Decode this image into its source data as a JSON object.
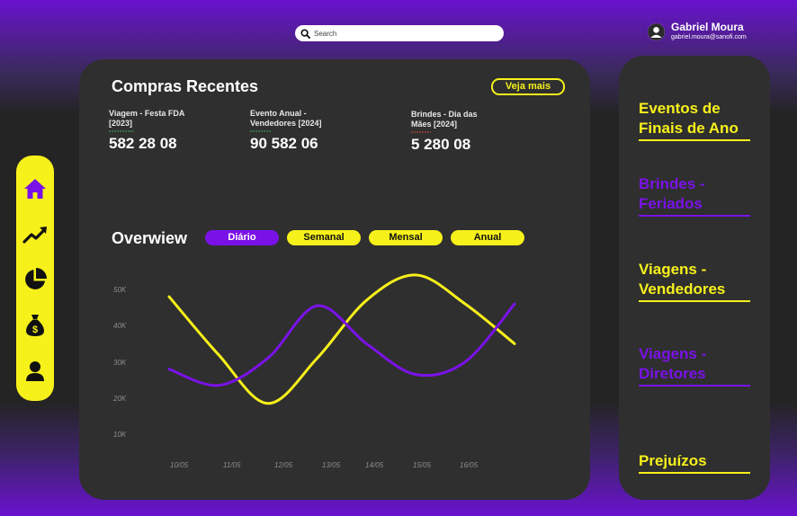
{
  "search": {
    "placeholder": "Search"
  },
  "user": {
    "name": "Gabriel Moura",
    "email": "gabriel.moura@sanofi.com"
  },
  "recent": {
    "title": "Compras Recentes",
    "see_more": "Veja mais",
    "items": [
      {
        "title_line1": "Viagem - Festa FDA",
        "title_line2": "[2023]",
        "amount": "582 28 08",
        "spark_color": "#3fae5a"
      },
      {
        "title_line1": "Evento Anual -",
        "title_line2": "Vendedores [2024]",
        "amount": "90 582 06",
        "spark_color": "#3fae5a"
      },
      {
        "title_line1": "Brindes - Dia das",
        "title_line2": "Mães [2024]",
        "amount": "5 280 08",
        "spark_color": "#d9483b"
      }
    ]
  },
  "overview": {
    "title": "Overwiew",
    "periods": [
      {
        "label": "Diário",
        "active": true
      },
      {
        "label": "Semanal",
        "active": false
      },
      {
        "label": "Mensal",
        "active": false
      },
      {
        "label": "Anual",
        "active": false
      }
    ]
  },
  "nav": {
    "items": [
      {
        "icon": "home-icon"
      },
      {
        "icon": "trending-up-icon"
      },
      {
        "icon": "pie-chart-icon"
      },
      {
        "icon": "money-bag-icon"
      },
      {
        "icon": "user-icon"
      }
    ]
  },
  "side_links": [
    {
      "line1": "Eventos de",
      "line2": "Finais de Ano",
      "color": "#f7f11b"
    },
    {
      "line1": "Brindes -",
      "line2": "Feriados",
      "color": "#7a12e8"
    },
    {
      "line1": "Viagens -",
      "line2": "Vendedores",
      "color": "#f7f11b"
    },
    {
      "line1": "Viagens -",
      "line2": "Diretores",
      "color": "#7a12e8"
    },
    {
      "line1": "Prejuízos",
      "line2": "",
      "color": "#f7f11b"
    }
  ],
  "colors": {
    "accent_yellow": "#f7f11b",
    "accent_purple": "#7a12e8",
    "panel": "#2f2f2f"
  },
  "chart_data": {
    "type": "line",
    "categories": [
      "10/05",
      "11/05",
      "12/05",
      "13/05",
      "14/05",
      "15/05",
      "16/05"
    ],
    "y_ticks": [
      "50K",
      "40K",
      "30K",
      "20K",
      "10K"
    ],
    "ylim": [
      10000,
      50000
    ],
    "grid": false,
    "series": [
      {
        "color": "#f7f11b",
        "values": [
          48000,
          32000,
          18500,
          31000,
          47000,
          54000,
          46000,
          35000
        ]
      },
      {
        "color": "#7a12e8",
        "values": [
          28000,
          23500,
          31000,
          45500,
          35000,
          26500,
          30000,
          46000
        ]
      }
    ]
  }
}
